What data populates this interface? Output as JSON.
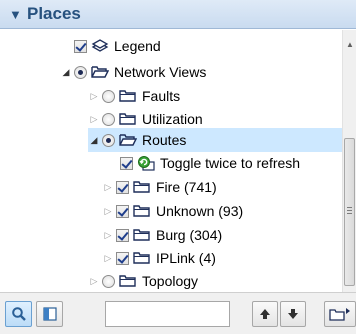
{
  "header": {
    "arrow": "▼",
    "title": "Places"
  },
  "tree": {
    "items": [
      {
        "label": "Legend",
        "checked": true
      },
      {
        "label": "Network Views",
        "selected_radio": true
      },
      {
        "label": "Faults"
      },
      {
        "label": "Utilization"
      },
      {
        "label": "Routes",
        "selected": true,
        "selected_radio": true
      },
      {
        "label": "Toggle twice to refresh",
        "checked": true
      },
      {
        "label": "Fire (741)",
        "checked": true
      },
      {
        "label": "Unknown (93)",
        "checked": true
      },
      {
        "label": "Burg (304)",
        "checked": true
      },
      {
        "label": "IPLink (4)",
        "checked": true
      },
      {
        "label": "Topology"
      }
    ]
  },
  "toolbar": {
    "search_value": ""
  },
  "colors": {
    "header_bg": "#c9dbf0",
    "header_text": "#27527f",
    "selection": "#cde8ff",
    "folder_outline": "#1f2f5a",
    "refresh_green": "#3aa336"
  }
}
